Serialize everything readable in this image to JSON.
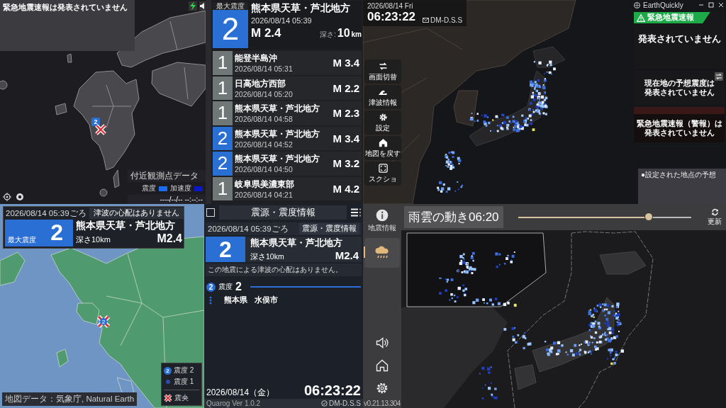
{
  "eew_map": {
    "banner": "緊急地震速報は発表されていません",
    "epicenter": {
      "intensity": "2",
      "color": "#2a6fd4"
    },
    "station_title": "付近観測点データ",
    "legend": [
      {
        "label": "震度",
        "color": "#1a6cf0"
      },
      {
        "label": "加速度",
        "color": "#0a18c8"
      }
    ],
    "timestamp": "----/--/-- --:--:--"
  },
  "quake_list": {
    "latest": {
      "caption": "最大震度",
      "intensity": "2",
      "color": "#2a6fd4",
      "place": "熊本県天草・芦北地方",
      "time": "2026/08/14 05:39",
      "magnitude": "M 2.4",
      "depth_label": "深さ:",
      "depth_value": "10",
      "depth_unit": "km"
    },
    "items": [
      {
        "intensity": "1",
        "color": "#6f7876",
        "place": "能登半島沖",
        "time": "2026/08/14 05:31",
        "magnitude": "M 3.4"
      },
      {
        "intensity": "1",
        "color": "#6f7876",
        "place": "日高地方西部",
        "time": "2026/08/14 05:20",
        "magnitude": "M 2.2"
      },
      {
        "intensity": "1",
        "color": "#6f7876",
        "place": "熊本県天草・芦北地方",
        "time": "2026/08/14 04:58",
        "magnitude": "M 2.3"
      },
      {
        "intensity": "2",
        "color": "#2a6fd4",
        "place": "熊本県天草・芦北地方",
        "time": "2026/08/14 04:52",
        "magnitude": "M 3.4"
      },
      {
        "intensity": "2",
        "color": "#2a6fd4",
        "place": "熊本県天草・芦北地方",
        "time": "2026/08/14 04:50",
        "magnitude": "M 3.2"
      },
      {
        "intensity": "1",
        "color": "#6f7876",
        "place": "岐阜県美濃東部",
        "time": "2026/08/14 04:21",
        "magnitude": "M 4.2"
      }
    ]
  },
  "earthquickly": {
    "date": "2026/08/14 Fri",
    "clock": "06:23:22",
    "source": "DM-D.S.S",
    "sidebar": [
      {
        "kind": "swap",
        "label": "画面切替"
      },
      {
        "kind": "wave",
        "label": "津波情報"
      },
      {
        "kind": "gear",
        "label": "設定"
      },
      {
        "kind": "home",
        "label": "地図を戻す"
      },
      {
        "kind": "capture",
        "label": "スクショ"
      }
    ],
    "app_title": "EarthQuickly",
    "eew_header": "緊急地震速報",
    "eew_status": "発表されていません",
    "forecast_lines": [
      "現在地の予想震度は",
      "発表されていません"
    ],
    "warning_lines": [
      "緊急地震速報（警報）は",
      "発表されていません"
    ],
    "points_caption": "●設定された地点の予想"
  },
  "intensity_map": {
    "time": "2026/08/14 05:39ごろ",
    "tsunami": "津波の心配はありません",
    "caption": "最大震度",
    "intensity": "2",
    "color": "#2a6fd4",
    "marker": {
      "intensity": "2",
      "color": "#2a6fd4"
    },
    "place": "熊本県天草・芦北地方",
    "depth": "深さ10km",
    "magnitude": "M2.4",
    "legend": [
      {
        "kind": "badge",
        "symbol": "2",
        "label": "震度",
        "value": "2",
        "color": "#2a6fd4"
      },
      {
        "kind": "dot",
        "label": "震度",
        "value": "1",
        "color": "#2a4fa8"
      }
    ],
    "epicenter_label": "震央",
    "credit": "地図データ：気象庁, Natural Earth"
  },
  "quarog": {
    "checked": false,
    "title": "震源・震度情報",
    "time": "2026/08/14 05:39ごろ",
    "tag": "震源・震度情報",
    "intensity": "2",
    "color": "#2a6fd4",
    "place": "熊本県天草・芦北地方",
    "depth": "深さ10km",
    "magnitude": "M2.4",
    "tsunami": "この地震による津波の心配はありません。",
    "groups": [
      {
        "intensity": "2",
        "color": "#2a6fd4",
        "label": "震度",
        "value": "2",
        "prefecture": "熊本県",
        "city": "水俣市"
      }
    ],
    "date": "2026/08/14（金）",
    "clock": "06:23:22",
    "version": "Quarog Ver 1.0.2",
    "source": "DM-D.S.S"
  },
  "rain_radar": {
    "sidebar": [
      {
        "kind": "info",
        "label": "地震情報",
        "selected": false
      },
      {
        "kind": "rain",
        "selected": true
      },
      {
        "kind": "sound",
        "selected": false
      },
      {
        "kind": "home",
        "selected": false
      },
      {
        "kind": "settings",
        "selected": false
      }
    ],
    "version": "v0.21.13.304",
    "title": "雨雲の動き06:20",
    "slider": {
      "level": 0.74
    },
    "refresh_label": "更新"
  }
}
